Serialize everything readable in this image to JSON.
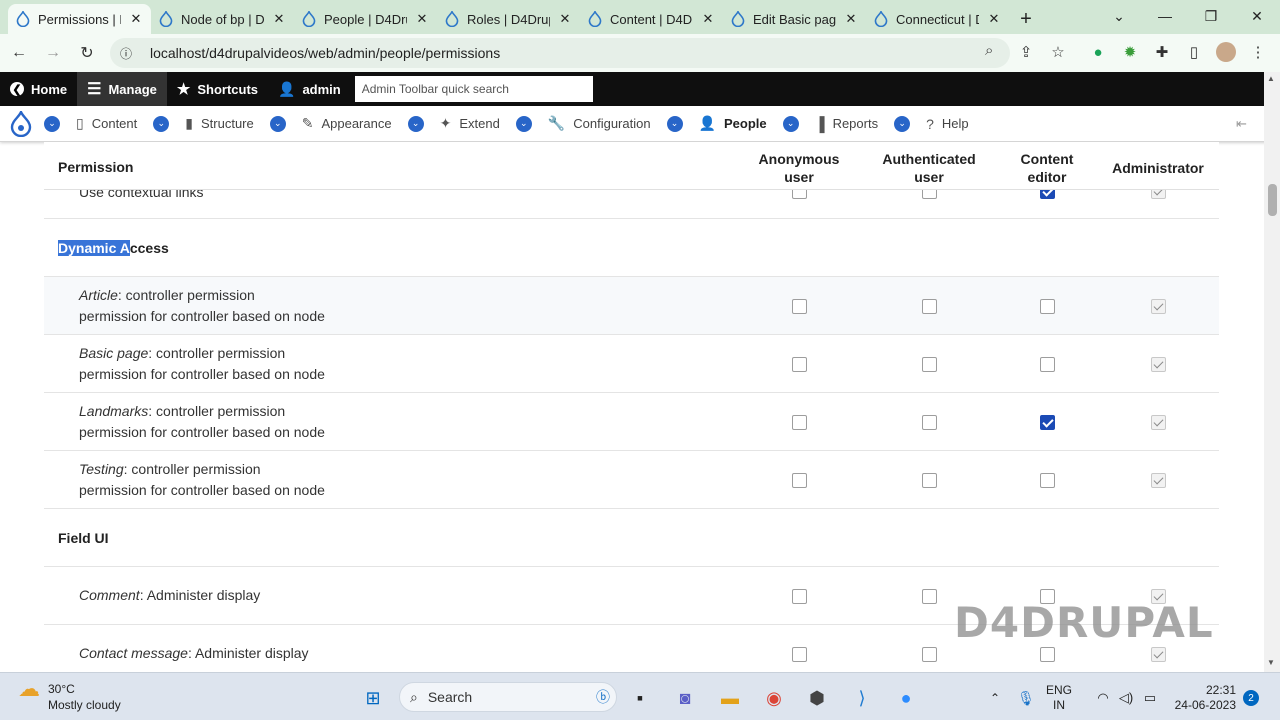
{
  "browser": {
    "tabs": [
      {
        "title": "Permissions | D",
        "active": true
      },
      {
        "title": "Node of bp | D",
        "active": false
      },
      {
        "title": "People | D4Dru",
        "active": false
      },
      {
        "title": "Roles | D4Drup",
        "active": false
      },
      {
        "title": "Content | D4D",
        "active": false
      },
      {
        "title": "Edit Basic page",
        "active": false
      },
      {
        "title": "Connecticut | D",
        "active": false
      }
    ],
    "url": "localhost/d4drupalvideos/web/admin/people/permissions"
  },
  "admin_toolbar": {
    "home": "Home",
    "manage": "Manage",
    "shortcuts": "Shortcuts",
    "user": "admin",
    "search_placeholder": "Admin Toolbar quick search"
  },
  "drupal_nav": {
    "items": [
      "Content",
      "Structure",
      "Appearance",
      "Extend",
      "Configuration",
      "People",
      "Reports",
      "Help"
    ],
    "current": "People"
  },
  "table": {
    "col_permission": "Permission",
    "roles": [
      {
        "line1": "Anonymous",
        "line2": "user"
      },
      {
        "line1": "Authenticated",
        "line2": "user"
      },
      {
        "line1": "Content",
        "line2": "editor"
      },
      {
        "line1": "Administrator",
        "line2": ""
      }
    ],
    "partial_row": {
      "text": "Use contextual links",
      "checks": [
        false,
        false,
        true,
        "admin"
      ]
    },
    "groups": [
      {
        "name_highlight": "Dynamic A",
        "name_rest": "ccess",
        "rows": [
          {
            "type": "Article",
            "line1": ": controller permission",
            "line2": "permission for controller based on node",
            "checks": [
              false,
              false,
              false,
              "admin"
            ]
          },
          {
            "type": "Basic page",
            "line1": ": controller permission",
            "line2": "permission for controller based on node",
            "checks": [
              false,
              false,
              false,
              "admin"
            ]
          },
          {
            "type": "Landmarks",
            "line1": ": controller permission",
            "line2": "permission for controller based on node",
            "checks": [
              false,
              false,
              true,
              "admin"
            ]
          },
          {
            "type": "Testing",
            "line1": ": controller permission",
            "line2": "permission for controller based on node",
            "checks": [
              false,
              false,
              false,
              "admin"
            ]
          }
        ]
      },
      {
        "name_highlight": "",
        "name_rest": "Field UI",
        "rows": [
          {
            "type": "Comment",
            "line1": ": Administer display",
            "line2": "",
            "checks": [
              false,
              false,
              false,
              "admin"
            ]
          },
          {
            "type": "Contact message",
            "line1": ": Administer display",
            "line2": "",
            "checks": [
              false,
              false,
              false,
              "admin"
            ]
          }
        ]
      }
    ]
  },
  "watermark": "D4DRUPAL",
  "taskbar": {
    "temp": "30°C",
    "weather": "Mostly cloudy",
    "search": "Search",
    "lang1": "ENG",
    "lang2": "IN",
    "time": "22:31",
    "date": "24-06-2023",
    "notif_count": "2"
  },
  "colors": {
    "accent": "#1b4ab5",
    "drupal_blue": "#2865c8",
    "toolbar_bg": "#0f0f0f",
    "tab_strip": "#d2e7d5"
  }
}
